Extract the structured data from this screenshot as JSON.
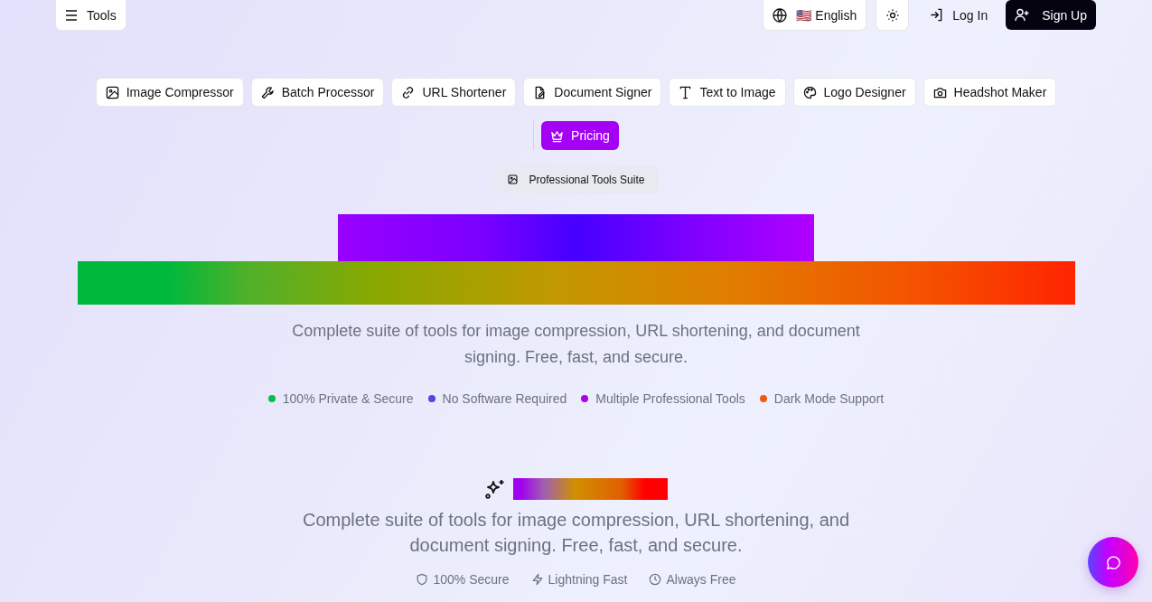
{
  "header": {
    "menu_button": "Tools",
    "language": {
      "flag": "🇺🇸",
      "label": "English"
    },
    "login": "Log In",
    "signup": "Sign Up"
  },
  "nav": [
    {
      "label": "Image Compressor",
      "kind": "tool"
    },
    {
      "label": "Batch Processor",
      "kind": "tool"
    },
    {
      "label": "URL Shortener",
      "kind": "tool"
    },
    {
      "label": "Document Signer",
      "kind": "tool"
    },
    {
      "label": "Text to Image",
      "kind": "tool"
    },
    {
      "label": "Logo Designer",
      "kind": "tool"
    },
    {
      "label": "Headshot Maker",
      "kind": "tool"
    },
    {
      "label": "Pricing",
      "kind": "pricing"
    }
  ],
  "hero": {
    "badge": "Professional Tools Suite",
    "description": "Complete suite of tools for image compression, URL shortening, and document signing. Free, fast, and secure.",
    "features": [
      {
        "label": "100% Private & Secure",
        "color": "#00c04b"
      },
      {
        "label": "No Software Required",
        "color": "#4f46e5"
      },
      {
        "label": "Multiple Professional Tools",
        "color": "#b000e8"
      },
      {
        "label": "Dark Mode Support",
        "color": "#f05a10"
      }
    ]
  },
  "section": {
    "description": "Complete suite of tools for image compression, URL shortening, and document signing. Free, fast, and secure.",
    "trust": [
      {
        "label": "100% Secure"
      },
      {
        "label": "Lightning Fast"
      },
      {
        "label": "Always Free"
      }
    ]
  }
}
